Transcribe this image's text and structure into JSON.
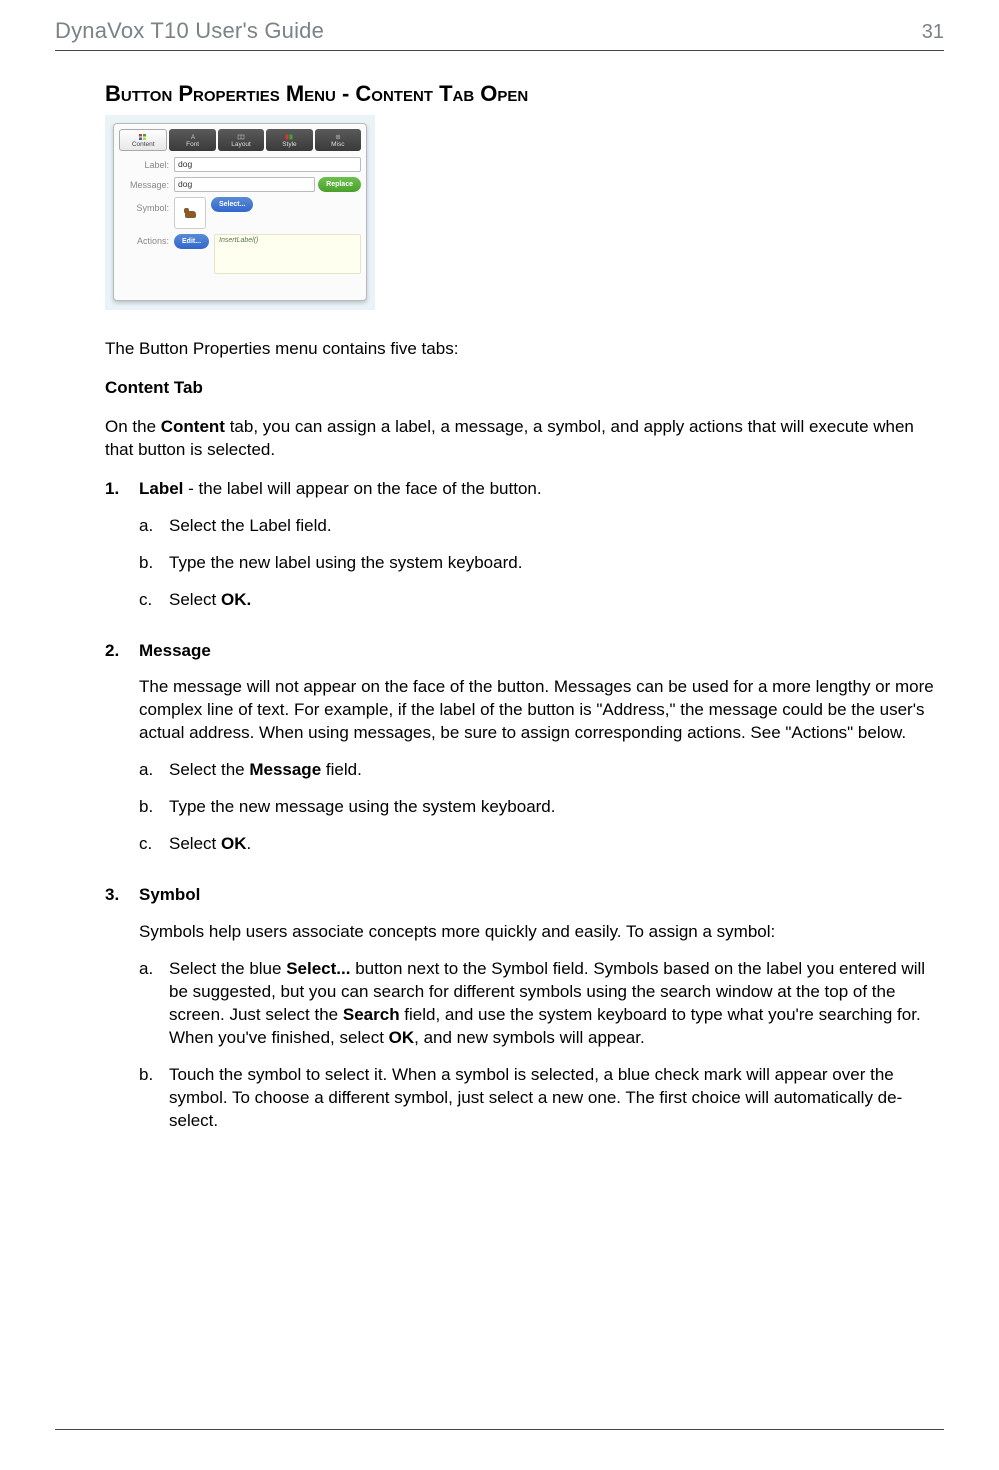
{
  "header": {
    "title": "DynaVox T10 User's Guide",
    "page_number": "31"
  },
  "section_heading": "Button Properties Menu - Content Tab Open",
  "mock": {
    "tabs": [
      "Content",
      "Font",
      "Layout",
      "Style",
      "Misc"
    ],
    "label_field_label": "Label:",
    "label_value": "dog",
    "message_field_label": "Message:",
    "message_value": "dog",
    "replace_btn": "Replace",
    "symbol_field_label": "Symbol:",
    "select_btn": "Select...",
    "actions_field_label": "Actions:",
    "edit_btn": "Edit...",
    "action_hint": "InsertLabel()"
  },
  "intro": "The Button Properties menu contains five tabs:",
  "content_tab_title": "Content Tab",
  "content_tab_desc_pre": "On the ",
  "content_tab_desc_bold": "Content",
  "content_tab_desc_post": " tab, you can assign a label, a message, a symbol, and apply actions that will execute when that button is selected.",
  "items": {
    "one": {
      "marker": "1.",
      "title": "Label",
      "title_rest": " - the label will appear on the face of the button.",
      "a_marker": "a.",
      "a": "Select the Label field.",
      "b_marker": "b.",
      "b": "Type the new label using the system keyboard.",
      "c_marker": "c.",
      "c_pre": "Select ",
      "c_bold": "OK."
    },
    "two": {
      "marker": "2.",
      "title": "Message",
      "desc": "The message will not appear on the face of the button. Messages can be used for a more lengthy or more complex line of text. For example, if the label of the button is \"Address,\" the message could be the user's actual address. When using messages, be sure to assign corresponding actions. See \"Actions\" below.",
      "a_marker": "a.",
      "a_pre": "Select the ",
      "a_bold": "Message",
      "a_post": " field.",
      "b_marker": "b.",
      "b": "Type the new message using the system keyboard.",
      "c_marker": "c.",
      "c_pre": "Select ",
      "c_bold": "OK",
      "c_post": "."
    },
    "three": {
      "marker": "3.",
      "title": "Symbol",
      "desc": "Symbols help users associate concepts more quickly and easily. To assign a symbol:",
      "a_marker": "a.",
      "a_pre": "Select the blue ",
      "a_bold1": "Select...",
      "a_mid1": " button next to the Symbol field. Symbols based on the label you entered will be suggested, but you can search for different symbols using the search window at the top of the screen. Just select the ",
      "a_bold2": "Search",
      "a_mid2": " field, and use the system keyboard to type what you're searching for. When you've finished, select ",
      "a_bold3": "OK",
      "a_post": ", and new symbols will appear.",
      "b_marker": "b.",
      "b": "Touch the symbol to select it. When a symbol is selected, a blue check mark will appear over the symbol. To choose a different symbol, just select a new one. The first choice will automatically de-select."
    }
  }
}
